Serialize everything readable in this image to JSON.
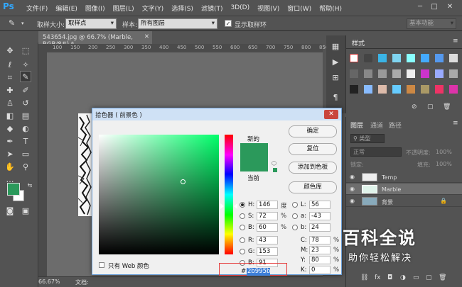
{
  "app": {
    "logo": "Ps",
    "menu": [
      "文件(F)",
      "编辑(E)",
      "图像(I)",
      "图层(L)",
      "文字(Y)",
      "选择(S)",
      "滤镜(T)",
      "3D(D)",
      "视图(V)",
      "窗口(W)",
      "帮助(H)"
    ]
  },
  "options": {
    "sample_size_label": "取样大小:",
    "sample_size_value": "取样点",
    "sample_label": "样本:",
    "sample_value": "所有图层",
    "show_ring_label": "显示取样环",
    "workspace_value": "基本功能"
  },
  "document": {
    "tab_title": "543654.jpg @ 66.7% (Marble, RGB/8#) *",
    "ruler_ticks": [
      "100",
      "150",
      "200",
      "250",
      "300",
      "350",
      "400",
      "450",
      "500",
      "550",
      "600",
      "650",
      "700",
      "750",
      "800",
      "850"
    ],
    "zoom": "66.67%",
    "status_text": "文档:"
  },
  "panels": {
    "styles_tab": "样式",
    "layers_tabs": [
      "图层",
      "通道",
      "路径"
    ],
    "kind_label": "类型",
    "blend_mode": "正常",
    "opacity_label": "不透明度:",
    "opacity_value": "100%",
    "lock_label": "锁定:",
    "fill_label": "填充:",
    "fill_value": "100%",
    "layers": [
      {
        "name": "Temp"
      },
      {
        "name": "Marble"
      },
      {
        "name": "背景"
      }
    ]
  },
  "picker": {
    "title": "拾色器 ( 前景色 )",
    "new_label": "新的",
    "current_label": "当前",
    "buttons": [
      "确定",
      "复位",
      "添加到色板",
      "颜色库"
    ],
    "web_only_label": "只有 Web 颜色",
    "hsb": [
      {
        "label": "H:",
        "value": "146",
        "unit": "度"
      },
      {
        "label": "S:",
        "value": "72",
        "unit": "%"
      },
      {
        "label": "B:",
        "value": "60",
        "unit": "%"
      }
    ],
    "rgb": [
      {
        "label": "R:",
        "value": "43"
      },
      {
        "label": "G:",
        "value": "153"
      },
      {
        "label": "B:",
        "value": "91"
      }
    ],
    "lab": [
      {
        "label": "L:",
        "value": "56"
      },
      {
        "label": "a:",
        "value": "-43"
      },
      {
        "label": "b:",
        "value": "24"
      }
    ],
    "cmyk": [
      {
        "label": "C:",
        "value": "78",
        "unit": "%"
      },
      {
        "label": "M:",
        "value": "23",
        "unit": "%"
      },
      {
        "label": "Y:",
        "value": "80",
        "unit": "%"
      },
      {
        "label": "K:",
        "value": "0",
        "unit": "%"
      }
    ],
    "hex_label": "#",
    "hex_value": "2b995b",
    "color": "#2b995b"
  },
  "watermark": {
    "title": "百科全说",
    "subtitle": "助你轻松解决"
  }
}
